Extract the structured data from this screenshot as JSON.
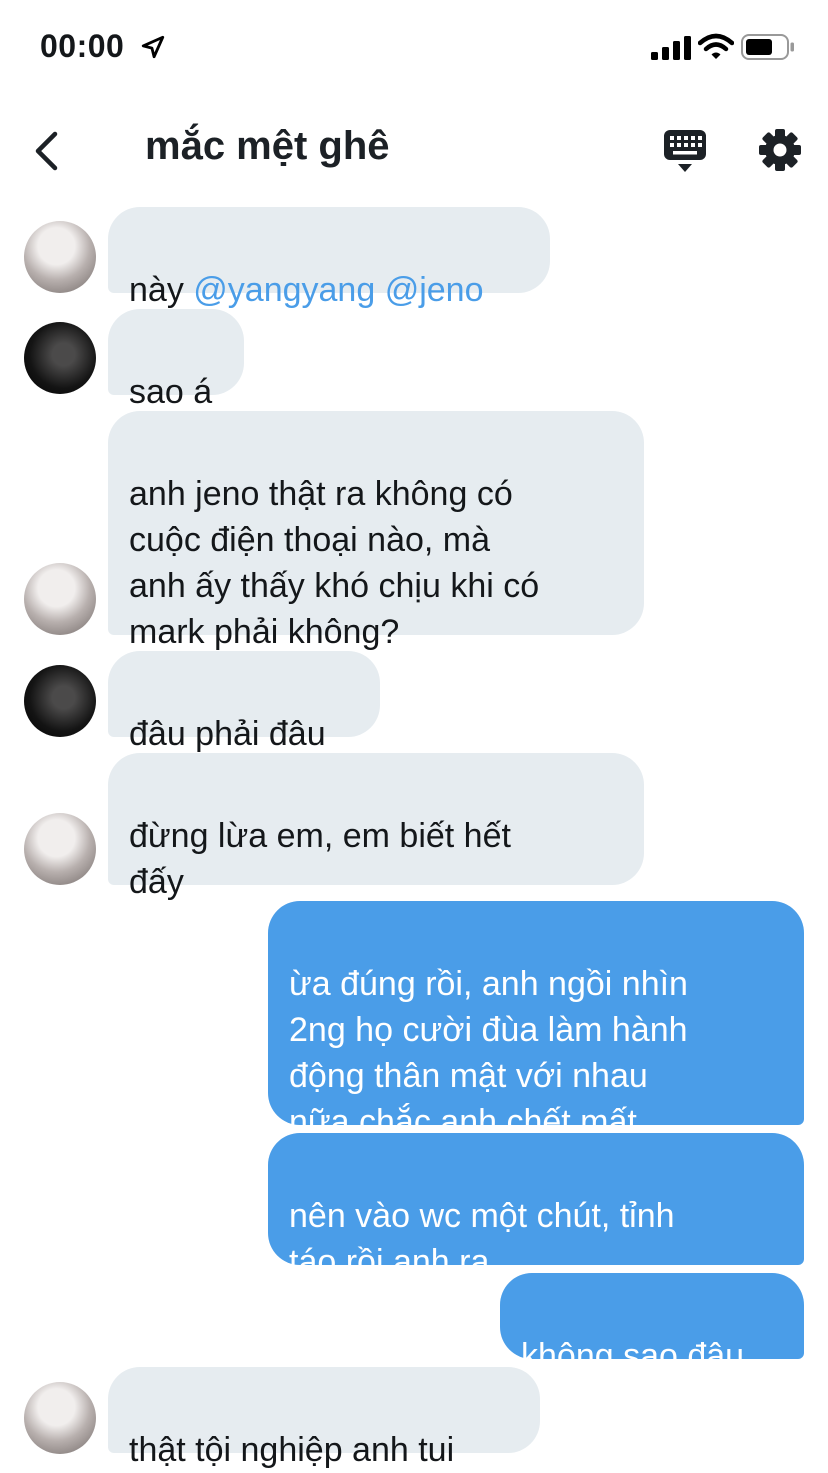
{
  "status_bar": {
    "time": "00:00"
  },
  "header": {
    "title": "mắc mệt ghê"
  },
  "messages": [
    {
      "direction": "in",
      "avatar": "light",
      "prefix": "này ",
      "mentions": [
        "@yangyang",
        "@jeno"
      ]
    },
    {
      "direction": "in",
      "avatar": "dark",
      "text": "sao á"
    },
    {
      "direction": "in",
      "avatar": "light",
      "text": "anh jeno thật ra không có\ncuộc điện thoại nào, mà\nanh ấy thấy khó chịu khi có\nmark phải không?"
    },
    {
      "direction": "in",
      "avatar": "dark",
      "text": "đâu phải đâu"
    },
    {
      "direction": "in",
      "avatar": "light",
      "text": "đừng lừa em, em biết hết\nđấy"
    },
    {
      "direction": "out",
      "text": "ừa đúng rồi, anh ngồi nhìn\n2ng họ cười đùa làm hành\nđộng thân mật với nhau\nnữa chắc anh chết mất"
    },
    {
      "direction": "out",
      "text": "nên vào wc một chút, tỉnh\ntáo rồi anh ra"
    },
    {
      "direction": "out",
      "text": "không sao đâu"
    },
    {
      "direction": "in",
      "avatar": "light",
      "text": "thật tội nghiệp anh tui"
    }
  ],
  "colors": {
    "accent": "#4a9de8",
    "incoming_bubble": "#e6ecf0",
    "outgoing_text": "#ffffff"
  },
  "icons": [
    "location-arrow-icon",
    "signal-icon",
    "wifi-icon",
    "battery-icon",
    "back-chevron-icon",
    "keyboard-icon",
    "gear-icon"
  ]
}
